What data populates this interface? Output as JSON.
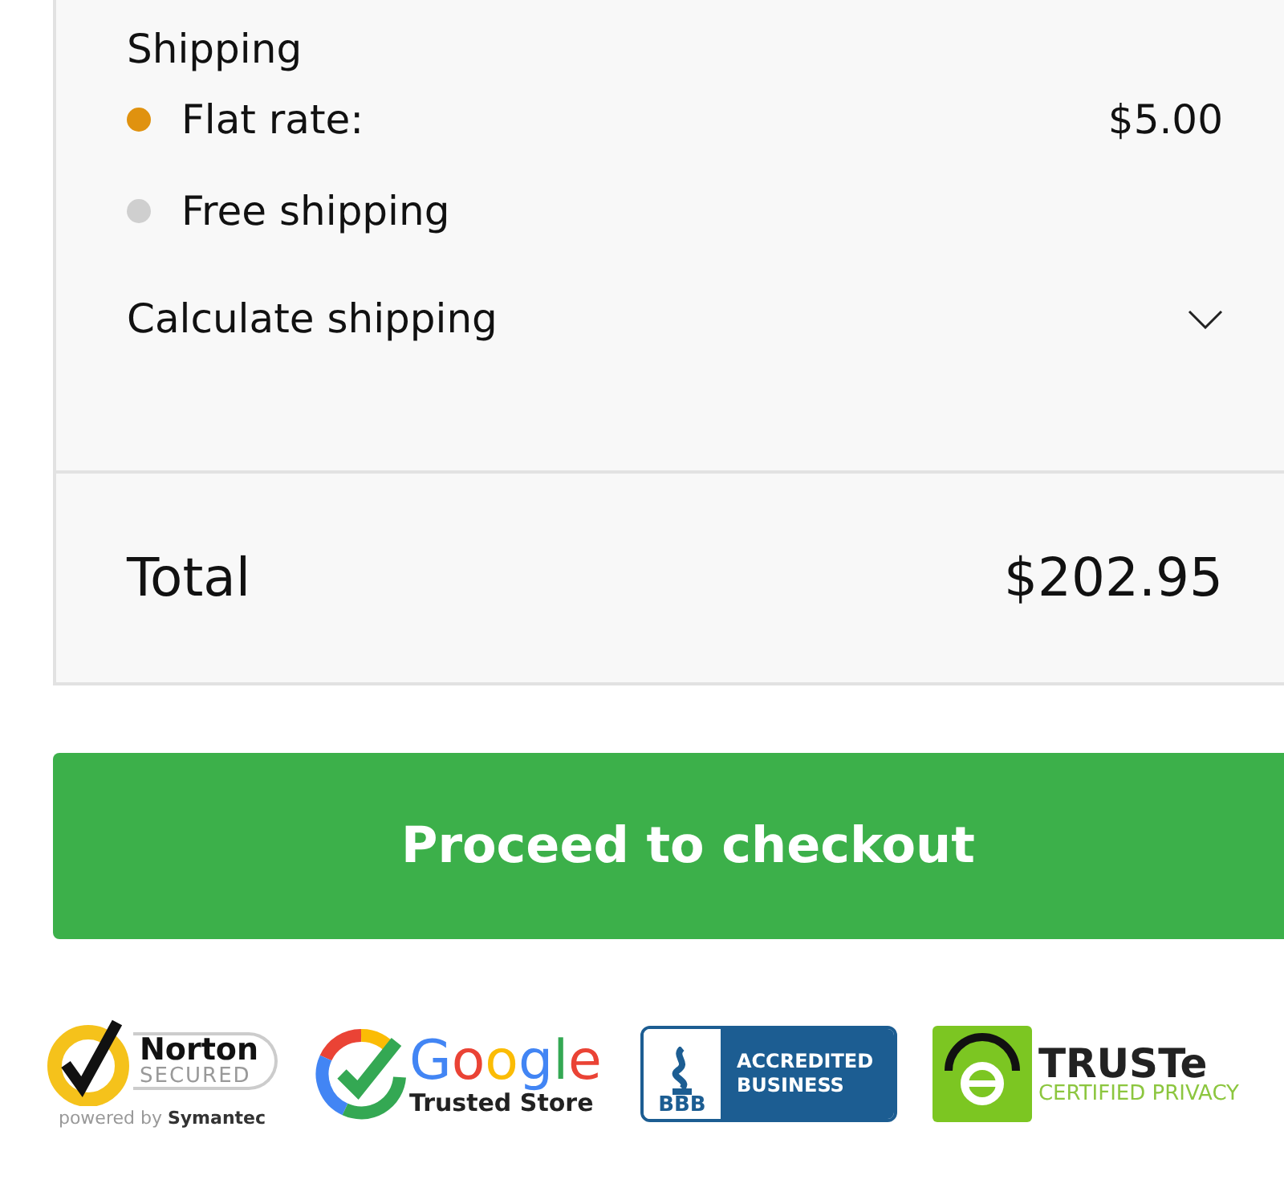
{
  "shipping": {
    "heading": "Shipping",
    "options": [
      {
        "label": "Flat rate:",
        "price": "$5.00",
        "selected": true
      },
      {
        "label": "Free shipping",
        "selected": false
      }
    ],
    "calculate": {
      "label": "Calculate shipping",
      "expanded": false
    }
  },
  "total": {
    "label": "Total",
    "amount": "$202.95"
  },
  "checkout_button": "Proceed to checkout",
  "badges": [
    {
      "kind": "norton",
      "title": "Norton",
      "subtitle": "SECURED",
      "footer_prefix": "powered by",
      "footer_brand": "Symantec"
    },
    {
      "kind": "google",
      "title": "Google",
      "subtitle": "Trusted Store"
    },
    {
      "kind": "bbb",
      "mark": "BBB",
      "title": "ACCREDITED",
      "subtitle": "BUSINESS"
    },
    {
      "kind": "truste",
      "title": "TRUSTe",
      "subtitle": "CERTIFIED PRIVACY"
    }
  ]
}
